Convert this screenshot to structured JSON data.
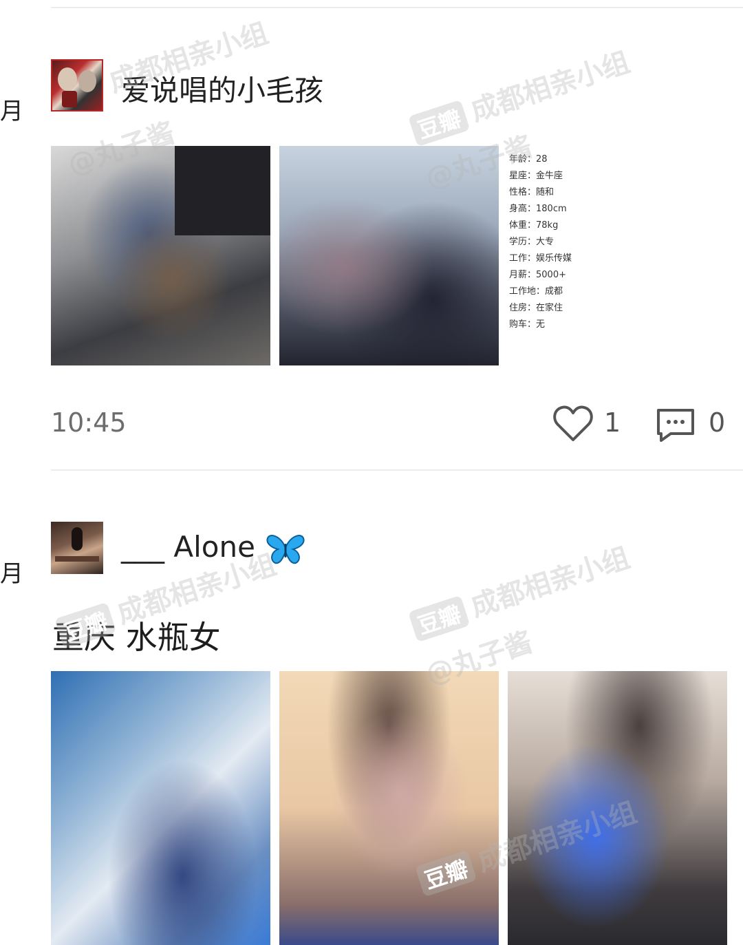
{
  "feed": {
    "posts": [
      {
        "side_label": "月",
        "username": "爱说唱的小毛孩",
        "profile": {
          "rows": [
            "年龄：28",
            "星座：金牛座",
            "性格：随和",
            "身高：180cm",
            "体重：78kg",
            "学历：大专",
            "工作：娱乐传媒",
            "月薪：5000+",
            "工作地：成都",
            "住房：在家住",
            "购车：无"
          ]
        },
        "time": "10:45",
        "like_count": "1",
        "comment_count": "0"
      },
      {
        "side_label": "月",
        "username": "___ Alone",
        "title": "重庆 水瓶女"
      }
    ]
  },
  "watermark": {
    "badge": "豆瓣",
    "group": "成都相亲小组",
    "author": "@丸子酱"
  },
  "icons": {
    "like": "heart-outline-icon",
    "comment": "comment-bubble-icon",
    "emoji": "butterfly-icon"
  },
  "colors": {
    "text": "#222222",
    "muted": "#6d6d6d",
    "divider": "#ececec",
    "butterfly": "#29a8f0"
  }
}
